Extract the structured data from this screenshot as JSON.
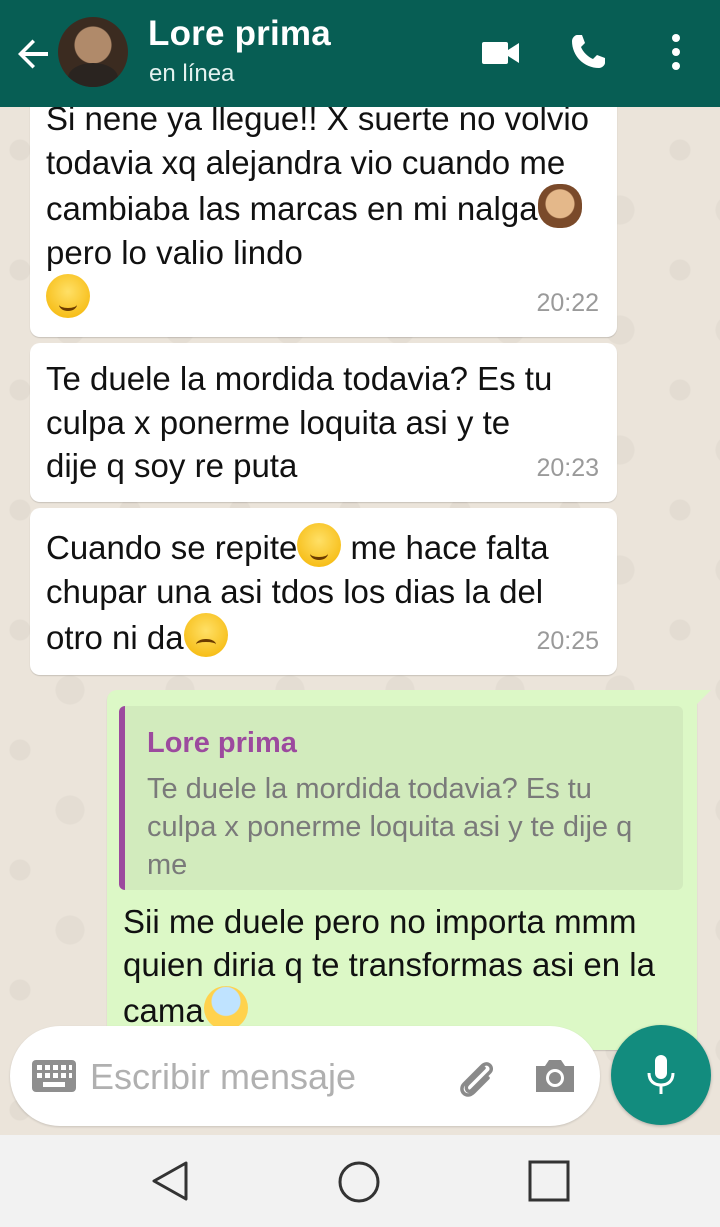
{
  "header": {
    "contact_name": "Lore prima",
    "status": "en línea"
  },
  "messages": [
    {
      "direction": "incoming",
      "parts": [
        "Si nene ya llegue!! X suerte no volvio todavia xq alejandra vio cuando me cambiaba las marcas en mi nalga",
        " pero lo valio lindo"
      ],
      "emojis": [
        "see-no-evil-monkey",
        "face-savoring-food"
      ],
      "time": "20:22"
    },
    {
      "direction": "incoming",
      "text": "Te duele la mordida todavia? Es tu culpa x ponerme loquita asi y te dije q soy re puta",
      "time": "20:23"
    },
    {
      "direction": "incoming",
      "parts": [
        "Cuando se repite",
        " me hace falta chupar una asi tdos los dias la del otro ni da"
      ],
      "emojis": [
        "face-savoring-food",
        "frowning-face"
      ],
      "time": "20:25"
    },
    {
      "direction": "outgoing",
      "quote": {
        "author": "Lore prima",
        "text": "Te duele la mordida todavia? Es tu culpa x ponerme loquita asi y te dije q me"
      },
      "text": "Sii me duele pero no importa mmm quien diria q te transformas asi en la cama",
      "emojis": [
        "face-screaming-in-fear"
      ]
    }
  ],
  "composer": {
    "placeholder": "Escribir mensaje"
  },
  "colors": {
    "header": "#075e54",
    "outgoing_bubble": "#dcf8c6",
    "mic_button": "#128c7e",
    "quote_author": "#9c4a9e"
  }
}
